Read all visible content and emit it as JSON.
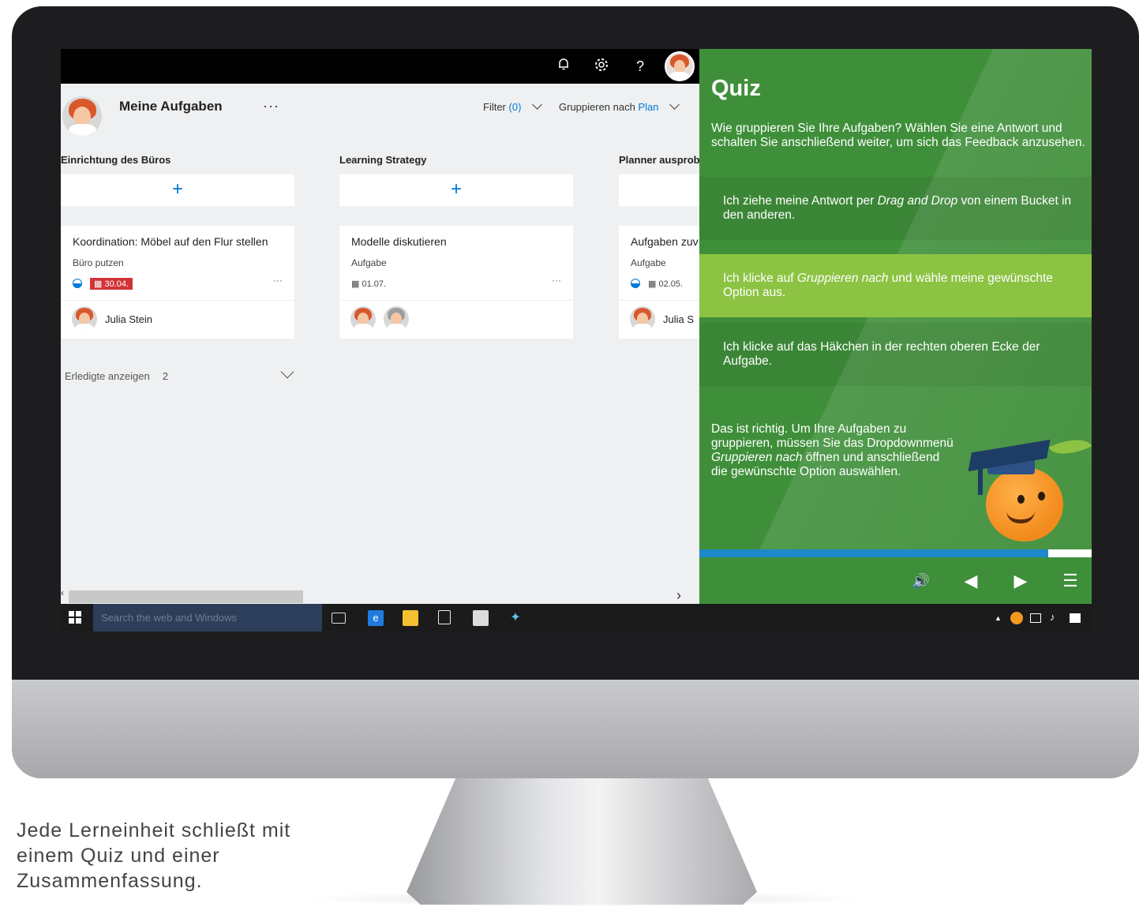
{
  "planner": {
    "topbar": {
      "icons": [
        "bell-icon",
        "gear-icon",
        "help-icon",
        "avatar"
      ],
      "help_glyph": "?"
    },
    "header": {
      "title": "Meine Aufgaben",
      "more": "···",
      "filter_label": "Filter",
      "filter_count": "(0)",
      "group_label": "Gruppieren nach",
      "group_value": "Plan"
    },
    "buckets": [
      {
        "title": "Einrichtung des Büros",
        "add": "+",
        "card": {
          "title": "Koordination: Möbel auf den Flur stellen",
          "label": "Büro putzen",
          "date": "30.04.",
          "assignee": "Julia Stein"
        }
      },
      {
        "title": "Learning Strategy",
        "add": "+",
        "card": {
          "title": "Modelle diskutieren",
          "label": "Aufgabe",
          "date": "01.07.",
          "assignee": ""
        }
      },
      {
        "title": "Planner ausprob",
        "add": "+",
        "card": {
          "title": "Aufgaben zuv",
          "label": "Aufgabe",
          "date": "02.05.",
          "assignee": "Julia S"
        }
      }
    ],
    "done": {
      "label": "Erledigte anzeigen",
      "count": "2"
    },
    "card_more": "···",
    "scroll_right": "›",
    "scroll_left": "‹"
  },
  "quiz": {
    "title": "Quiz",
    "question": "Wie gruppieren Sie Ihre Aufgaben? Wählen Sie eine Antwort und schalten Sie anschließend weiter, um sich das Feedback anzusehen.",
    "options": [
      {
        "pre": "Ich ziehe meine Antwort per ",
        "em": "Drag and Drop",
        "post": " von einem Bucket in den anderen.",
        "selected": false
      },
      {
        "pre": "Ich klicke auf ",
        "em": "Gruppieren nach",
        "post": " und wähle meine gewünschte Option aus.",
        "selected": true
      },
      {
        "pre": "Ich klicke auf das Häkchen in der rechten oberen Ecke der Aufgabe.",
        "em": "",
        "post": "",
        "selected": false
      }
    ],
    "feedback": {
      "pre": "Das ist richtig. Um Ihre Aufgaben zu gruppieren, müssen Sie das Dropdownmenü ",
      "em": "Gruppieren nach",
      "post": " öffnen und anschließend die gewünschte Option auswählen."
    },
    "progress": 0.89,
    "controls": {
      "volume": "🔊",
      "prev": "◀",
      "next": "▶",
      "menu": "☰"
    },
    "colors": {
      "panel": "#3f8f3a",
      "selected": "#8cc342",
      "progress": "#1f88c9"
    }
  },
  "taskbar": {
    "search_placeholder": "Search the web and Windows",
    "apps": [
      "task-view-icon",
      "edge-icon",
      "file-explorer-icon",
      "store-icon",
      "news-icon",
      "app-icon"
    ],
    "tray": [
      "chevron-up-icon",
      "mascot-icon",
      "network-icon",
      "volume-icon",
      "notification-icon"
    ]
  },
  "caption": "Jede Lerneinheit schließt mit einem Quiz und einer Zusammenfassung."
}
